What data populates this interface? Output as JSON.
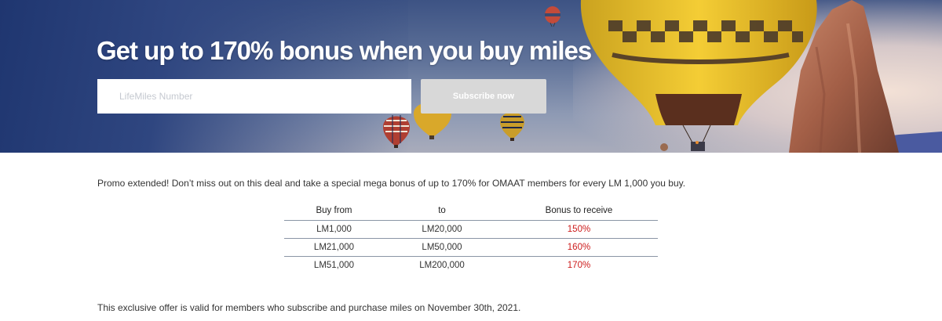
{
  "hero": {
    "title": "Get up to 170% bonus when you buy miles",
    "input_placeholder": "LifeMiles Number",
    "subscribe_label": "Subscribe now"
  },
  "promo_text": "Promo extended! Don’t miss out on this deal and take a special mega bonus of up to 170% for OMAAT members for every LM 1,000 you buy.",
  "table": {
    "headers": [
      "Buy from",
      "to",
      "Bonus to receive"
    ],
    "rows": [
      [
        "LM1,000",
        "LM20,000",
        "150%"
      ],
      [
        "LM21,000",
        "LM50,000",
        "160%"
      ],
      [
        "LM51,000",
        "LM200,000",
        "170%"
      ]
    ]
  },
  "footer_text": "This exclusive offer is valid for members who subscribe and purchase miles on November 30th, 2021.",
  "colors": {
    "bonus_text": "#cc1a1a",
    "button_bg": "#d8d8d8",
    "hero_sky": "#2f4680"
  }
}
